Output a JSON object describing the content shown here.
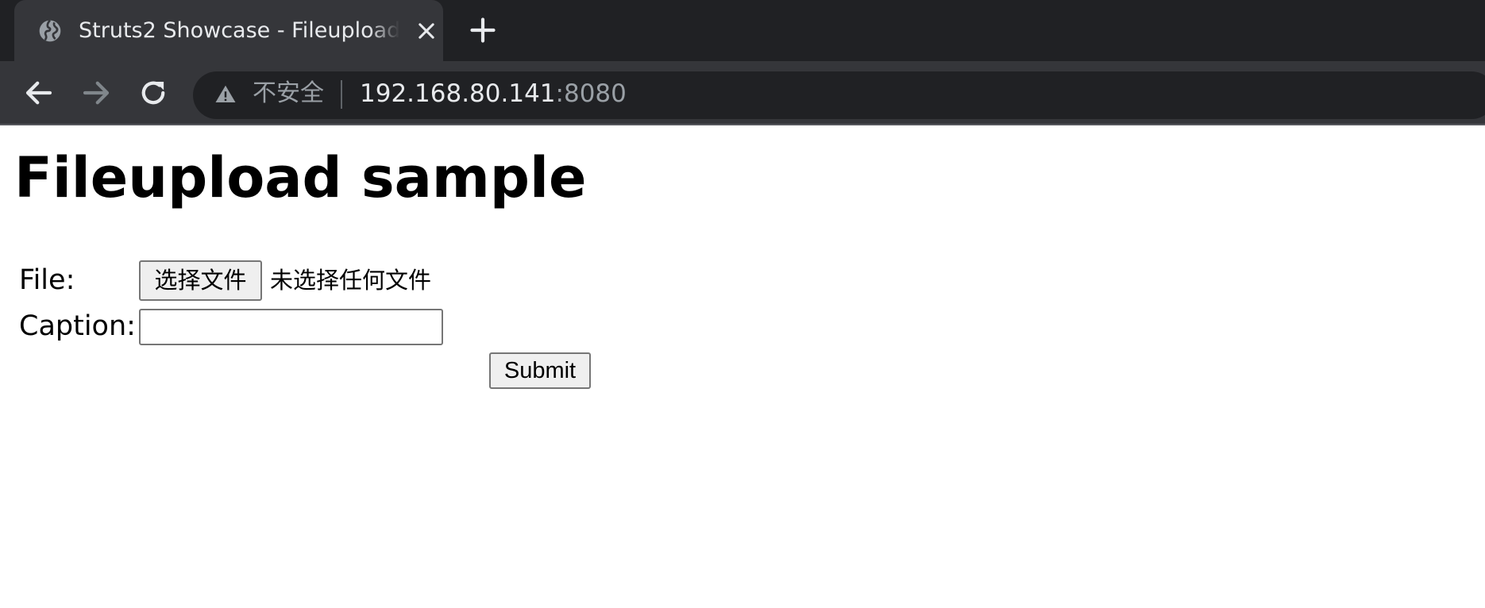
{
  "browser": {
    "tab": {
      "title": "Struts2 Showcase - Fileupload",
      "favicon": "globe-icon"
    },
    "new_tab_icon": "plus-icon",
    "nav": {
      "back_icon": "back-arrow-icon",
      "forward_icon": "forward-arrow-icon",
      "reload_icon": "reload-icon"
    },
    "address_bar": {
      "security_icon": "warning-icon",
      "security_label": "不安全",
      "host": "192.168.80.141",
      "port": ":8080"
    },
    "colors": {
      "frame": "#202124",
      "toolbar": "#35363a"
    }
  },
  "page": {
    "title": "Fileupload sample",
    "form": {
      "file_label": "File:",
      "file_button_label": "选择文件",
      "file_status": "未选择任何文件",
      "caption_label": "Caption:",
      "caption_value": "",
      "submit_label": "Submit"
    }
  }
}
